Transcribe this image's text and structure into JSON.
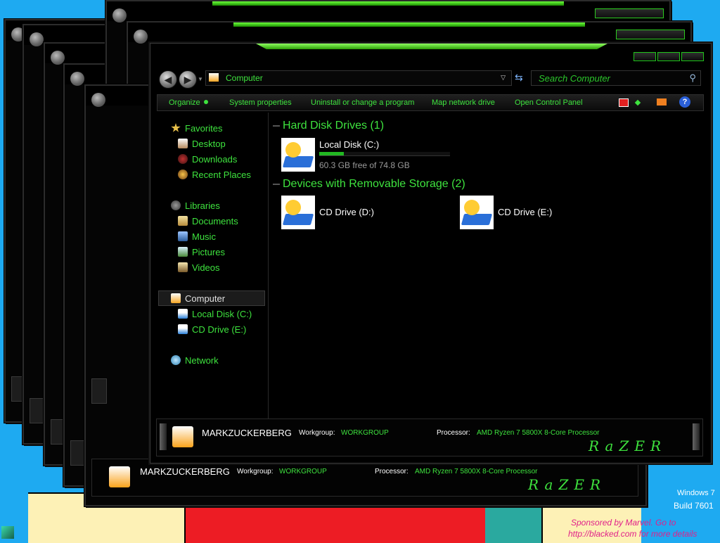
{
  "main_window": {
    "address": "Computer",
    "search_placeholder": "Search Computer",
    "toolbar": {
      "organize": "Organize",
      "system_properties": "System properties",
      "uninstall": "Uninstall or change a program",
      "map_drive": "Map network drive",
      "control_panel": "Open Control Panel"
    },
    "sidebar": {
      "favorites": "Favorites",
      "desktop": "Desktop",
      "downloads": "Downloads",
      "recent": "Recent Places",
      "libraries": "Libraries",
      "documents": "Documents",
      "music": "Music",
      "pictures": "Pictures",
      "videos": "Videos",
      "computer": "Computer",
      "local_disk": "Local Disk (C:)",
      "cd_drive": "CD Drive (E:)",
      "network": "Network"
    },
    "content": {
      "hdd_header": "Hard Disk Drives (1)",
      "local_disk_name": "Local Disk (C:)",
      "local_disk_free": "60.3 GB free of 74.8 GB",
      "local_disk_used_fraction": 0.19,
      "removable_header": "Devices with Removable Storage (2)",
      "cd_d": "CD Drive (D:)",
      "cd_e": "CD Drive (E:)"
    },
    "status": {
      "computer_name": "MARKZUCKERBERG",
      "workgroup_label": "Workgroup:",
      "workgroup": "WORKGROUP",
      "processor_label": "Processor:",
      "processor": "AMD Ryzen 7 5800X 8-Core Processor",
      "logo": "RaZER"
    }
  },
  "behind_window_status": {
    "computer_name": "MARKZUCKERBERG",
    "workgroup_label": "Workgroup:",
    "workgroup": "WORKGROUP",
    "processor_label": "Processor:",
    "processor": "AMD Ryzen 7 5800X 8-Core Processor",
    "logo": "RaZER"
  },
  "watermark": {
    "os": "Windows 7",
    "build": "Build 7601",
    "sponsor_line1": "Sponsored by Marvel. Go to",
    "sponsor_line2": "http://blacked.com for more details"
  },
  "colors": {
    "accent": "#3ee33e",
    "desktop": "#1eaaf1"
  }
}
